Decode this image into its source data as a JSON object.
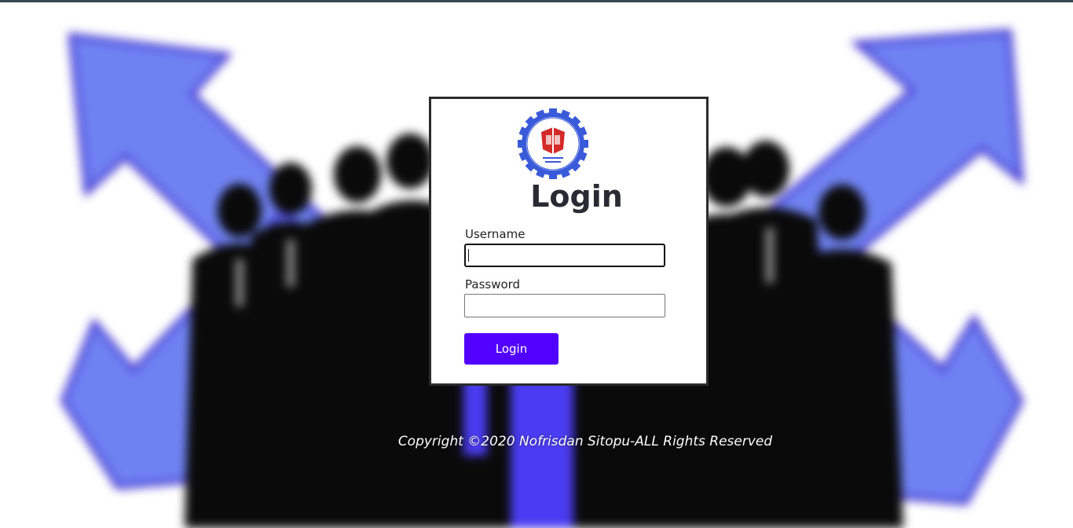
{
  "login": {
    "title": "Login",
    "username_label": "Username",
    "username_value": "",
    "password_label": "Password",
    "password_value": "",
    "button_label": "Login"
  },
  "logo": {
    "icon": "institution-gear-logo-icon",
    "ring_text": "HIMPUNAN MAHASISWA INFORMATIKA",
    "inner_text": "SEKOLAH TINGGI TEKNOLOGI",
    "colors": {
      "gear": "#3a5bd9",
      "book": "#d42a2a"
    }
  },
  "footer": {
    "copyright": "Copyright ©2020 Nofrisdan Sitopu-ALL Rights Reserved"
  },
  "theme": {
    "accent": "#5200ff",
    "topbar": "#37474f",
    "arrow_color": "#6a7ff0",
    "silhouette_color": "#0a0a0a"
  }
}
